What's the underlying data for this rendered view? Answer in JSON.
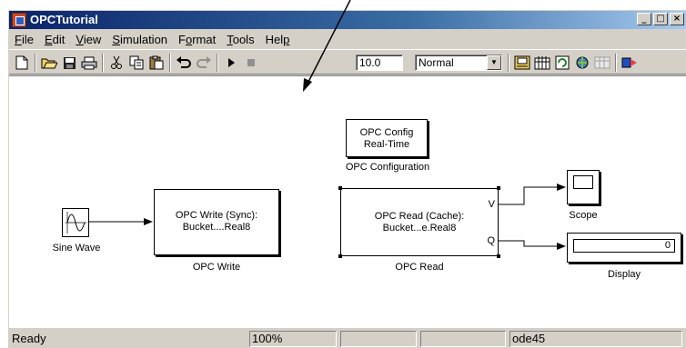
{
  "window": {
    "title": "OPCTutorial"
  },
  "window_buttons": {
    "minimize": "_",
    "maximize": "□",
    "close": "×"
  },
  "menu": [
    {
      "label": "File",
      "key": "F",
      "rest": "ile"
    },
    {
      "label": "Edit",
      "key": "E",
      "rest": "dit"
    },
    {
      "label": "View",
      "key": "V",
      "rest": "iew"
    },
    {
      "label": "Simulation",
      "key": "S",
      "rest": "imulation"
    },
    {
      "label": "Format",
      "key": "o",
      "pre": "F",
      "rest": "rmat"
    },
    {
      "label": "Tools",
      "key": "T",
      "rest": "ools"
    },
    {
      "label": "Help",
      "key": "p",
      "pre": "Hel",
      "rest": ""
    }
  ],
  "toolbar": {
    "stop_time": "10.0",
    "sim_mode": "Normal",
    "icons": [
      "new-model-icon",
      "open-icon",
      "save-icon",
      "print-icon",
      "cut-icon",
      "copy-icon",
      "paste-icon",
      "undo-icon",
      "redo-icon",
      "start-simulation-icon",
      "stop-simulation-icon",
      "build-icon",
      "library-browser-icon",
      "update-diagram-icon",
      "model-explorer-icon",
      "debugger-icon",
      "browser-icon"
    ]
  },
  "blocks": {
    "opc_config": {
      "line1": "OPC Config",
      "line2": "Real-Time",
      "caption": "OPC Configuration"
    },
    "sine_wave": {
      "caption": "Sine Wave"
    },
    "opc_write": {
      "line1": "OPC Write (Sync):",
      "line2": "Bucket....Real8",
      "caption": "OPC Write"
    },
    "opc_read": {
      "line1": "OPC Read (Cache):",
      "line2": "Bucket...e.Real8",
      "caption": "OPC Read",
      "port_v": "V",
      "port_q": "Q"
    },
    "scope": {
      "caption": "Scope"
    },
    "display": {
      "value": "0",
      "caption": "Display"
    }
  },
  "statusbar": {
    "status": "Ready",
    "zoom": "100%",
    "solver": "ode45"
  },
  "colors": {
    "title_start": "#0a246a",
    "title_end": "#a6caf0",
    "face": "#d4d0c8"
  }
}
